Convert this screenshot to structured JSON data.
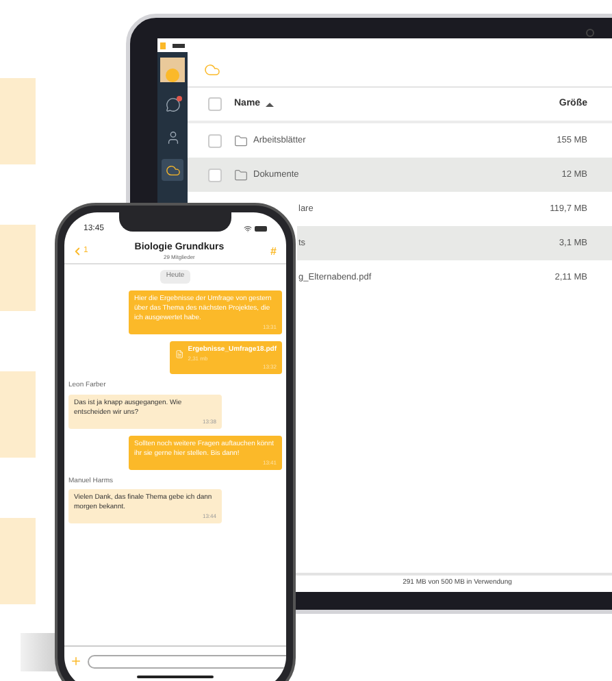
{
  "laptop": {
    "sidebar": {
      "items": [
        {
          "kind": "chat",
          "selected": false,
          "notification": true
        },
        {
          "kind": "contacts",
          "selected": false,
          "notification": false
        },
        {
          "kind": "cloud",
          "selected": true,
          "notification": false
        }
      ]
    },
    "files": {
      "all_checked": false,
      "columns": [
        {
          "label": "Name",
          "sorted": true
        },
        {
          "label": "Größe",
          "sorted": false
        }
      ],
      "rows": [
        {
          "kind": "folder",
          "name": "Arbeitsblätter",
          "size": "155 MB",
          "checked": false
        },
        {
          "kind": "folder",
          "name": "Dokumente",
          "size": "12 MB",
          "checked": false
        },
        {
          "kind": "covered",
          "name": "lare",
          "size": "119,7 MB"
        },
        {
          "kind": "covered",
          "name": "ts",
          "size": "3,1 MB"
        },
        {
          "kind": "covered",
          "name": "g_Elternabend.pdf",
          "size": "2,11 MB"
        }
      ]
    },
    "storage": "291 MB von 500 MB in Verwendung"
  },
  "phone": {
    "time": "13:45",
    "back_count": "1",
    "title": "Biologie Grundkurs",
    "subtitle": "29 Mitglieder",
    "action": "#",
    "date": "Heute",
    "messages": [
      {
        "kind": "outgoing",
        "text": "Hier die Ergebnisse der Umfrage von gestern über das Thema des nächsten Projektes, die ich ausgewertet habe.",
        "time": "13:31"
      },
      {
        "kind": "file",
        "name": "Ergebnisse_Umfrage18.pdf",
        "size": "2,31 mb",
        "time": "13:32"
      },
      {
        "kind": "incoming",
        "sender": "Leon Farber",
        "text": "Das ist ja knapp ausgegangen. Wie entscheiden wir uns?",
        "time": "13:38"
      },
      {
        "kind": "outgoing",
        "text": "Sollten noch weitere Fragen auftauchen könnt ihr sie gerne hier stellen. Bis dann!",
        "time": "13:41"
      },
      {
        "kind": "incoming",
        "sender": "Manuel Harms",
        "text": "Vielen Dank, das finale Thema gebe ich dann morgen bekannt.",
        "time": "13:44"
      }
    ]
  }
}
